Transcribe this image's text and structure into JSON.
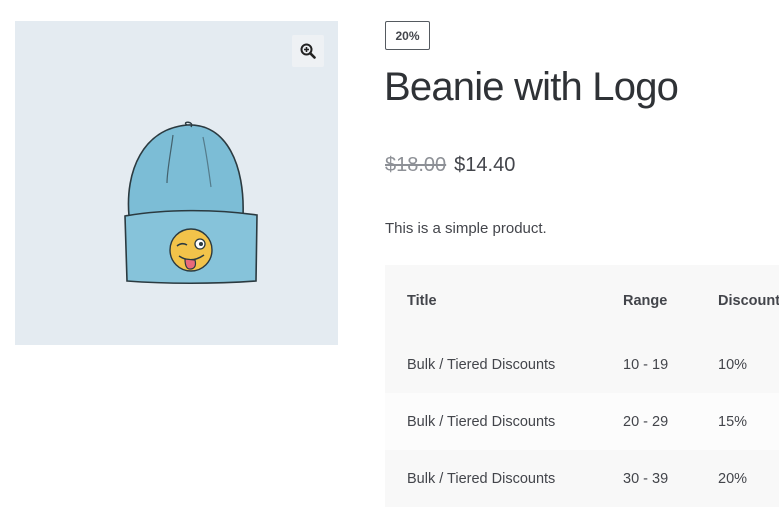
{
  "product": {
    "badge": "20%",
    "title": "Beanie with Logo",
    "regular_price": "$18.00",
    "sale_price": "$14.40",
    "short_description": "This is a simple product."
  },
  "gallery": {
    "zoom_icon": "magnifier-plus-icon",
    "image": "beanie-with-winking-emoji-logo",
    "background": "#e4ebf1",
    "beanie_color": "#7cbdd6"
  },
  "discount_table": {
    "headers": [
      "Title",
      "Range",
      "Discount"
    ],
    "rows": [
      {
        "title": "Bulk / Tiered Discounts",
        "range": "10 - 19",
        "discount": "10%"
      },
      {
        "title": "Bulk / Tiered Discounts",
        "range": "20 - 29",
        "discount": "15%"
      },
      {
        "title": "Bulk / Tiered Discounts",
        "range": "30 - 39",
        "discount": "20%"
      }
    ]
  }
}
